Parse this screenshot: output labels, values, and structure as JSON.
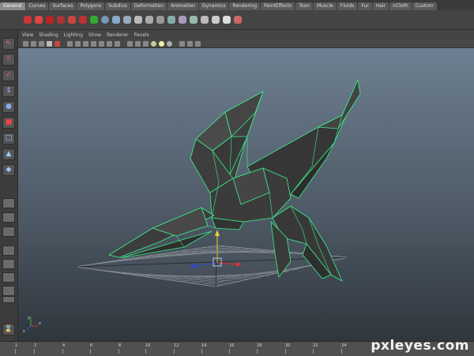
{
  "shelf": {
    "tabs": [
      "General",
      "Curves",
      "Surfaces",
      "Polygons",
      "Subdivs",
      "Deformation",
      "Animation",
      "Dynamics",
      "Rendering",
      "PaintEffects",
      "Toon",
      "Muscle",
      "Fluids",
      "Fur",
      "Hair",
      "nCloth",
      "Custom"
    ],
    "active_tab": "General"
  },
  "viewport": {
    "menus": [
      "View",
      "Shading",
      "Lighting",
      "Show",
      "Renderer",
      "Panels"
    ],
    "axis": {
      "x": "x",
      "y": "y",
      "z": "z"
    }
  },
  "timeline": {
    "ticks": [
      "1",
      "2",
      "4",
      "6",
      "8",
      "10",
      "12",
      "14",
      "16",
      "18",
      "20",
      "22",
      "24"
    ]
  },
  "watermark": "pxleyes.com",
  "colors": {
    "wireframe": "#3cf08c",
    "mesh_fill": "#3e3e3e",
    "viewport_top": "#6d7f91",
    "viewport_bottom": "#2f363d"
  }
}
